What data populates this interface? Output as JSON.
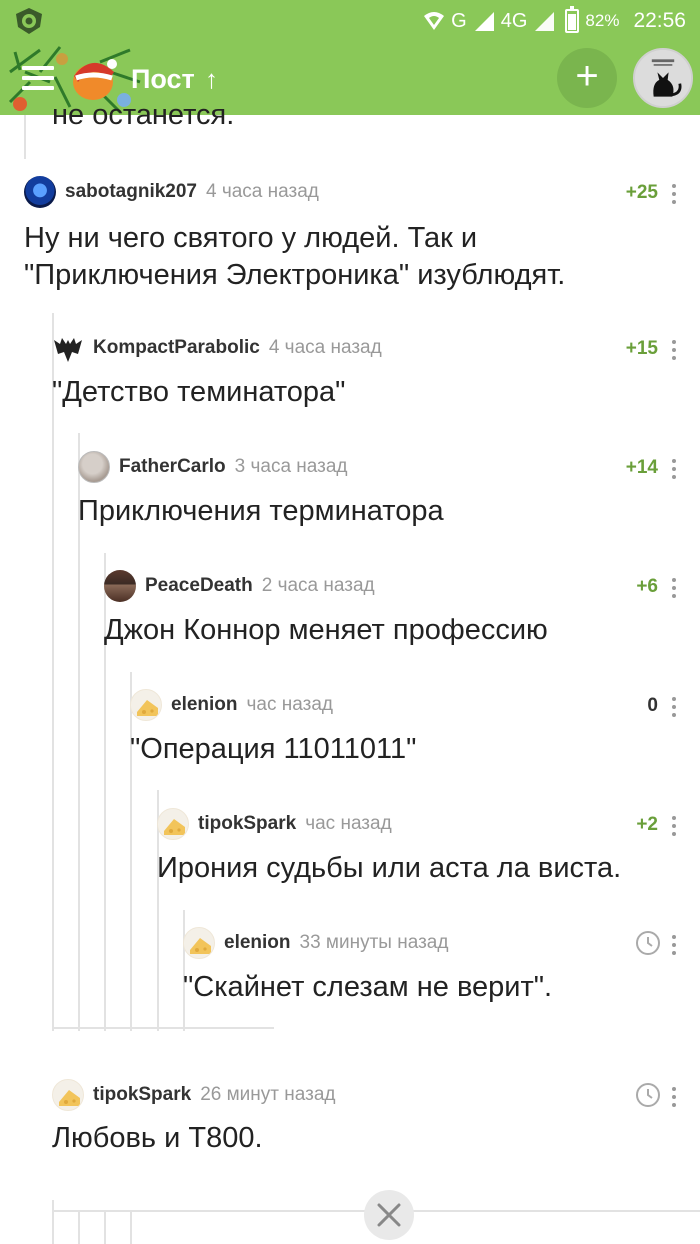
{
  "status_bar": {
    "network_g": "G",
    "network_4g": "4G",
    "battery": "82%",
    "battery_level": 0.82,
    "time": "22:56"
  },
  "toolbar": {
    "title": "Пост",
    "scroll_up_glyph": "↑",
    "add_glyph": "+"
  },
  "clipped_text": "не останется.",
  "comments": [
    {
      "user": "sabotagnik207",
      "time": "4 часа назад",
      "rating": "+25",
      "text_lines": [
        "Ну ни чего святого у людей. Так и",
        "\"Приключения Электроника\" изублюдят."
      ]
    },
    {
      "user": "KompactParabolic",
      "time": "4 часа назад",
      "rating": "+15",
      "text": "\"Детство теминатора\""
    },
    {
      "user": "FatherCarlo",
      "time": "3 часа назад",
      "rating": "+14",
      "text": "Приключения терминатора"
    },
    {
      "user": "PeaceDeath",
      "time": "2 часа назад",
      "rating": "+6",
      "text": "Джон Коннор меняет профессию"
    },
    {
      "user": "elenion",
      "time": "час назад",
      "rating": "0",
      "text": "\"Операция 11011011\""
    },
    {
      "user": "tipokSpark",
      "time": "час назад",
      "rating": "+2",
      "text": "Ирония судьбы или аста ла виста."
    },
    {
      "user": "elenion",
      "time": "33 минуты назад",
      "text": "\"Скайнет слезам не верит\"."
    },
    {
      "user": "tipokSpark",
      "time": "26 минут назад",
      "text": "Любовь и Т800."
    }
  ],
  "colors": {
    "brand_green": "#8ac858",
    "rating_green": "#6a9f3a",
    "meta_gray": "#999999"
  },
  "icons": [
    "app-logo-icon",
    "signal-icon",
    "battery-icon",
    "menu-icon",
    "scroll-up-icon",
    "add-icon",
    "clock-icon",
    "more-icon",
    "close-icon"
  ]
}
